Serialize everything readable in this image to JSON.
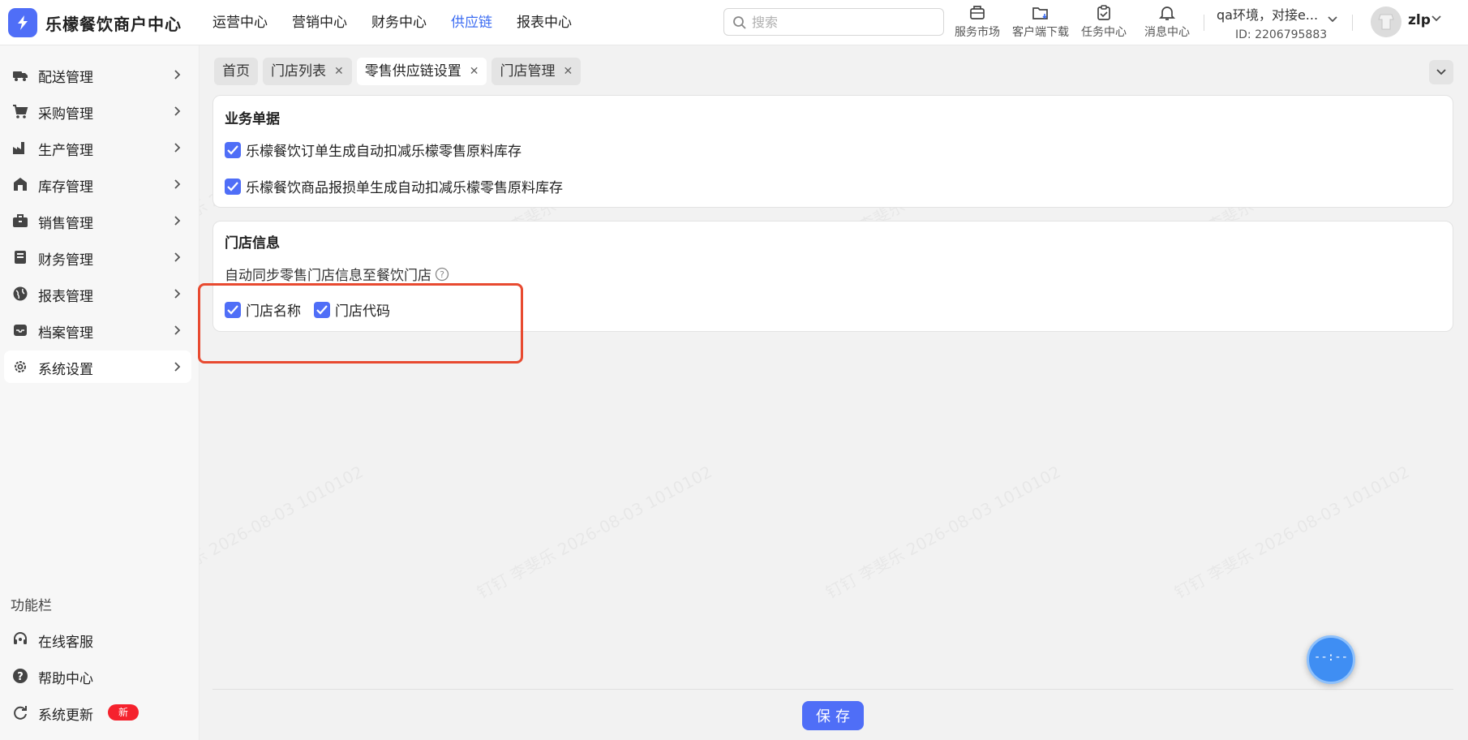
{
  "app": {
    "brand": "乐檬餐饮商户中心",
    "logo_icon": "lightning-logo-icon"
  },
  "nav": [
    {
      "label": "运营中心",
      "active": false
    },
    {
      "label": "营销中心",
      "active": false
    },
    {
      "label": "财务中心",
      "active": false
    },
    {
      "label": "供应链",
      "active": true
    },
    {
      "label": "报表中心",
      "active": false
    }
  ],
  "search": {
    "placeholder": "搜索",
    "value": ""
  },
  "tools": [
    {
      "label": "服务市场",
      "icon": "shop-icon"
    },
    {
      "label": "客户端下载",
      "icon": "download-folder-icon"
    },
    {
      "label": "任务中心",
      "icon": "clipboard-icon"
    },
    {
      "label": "消息中心",
      "icon": "bell-icon"
    }
  ],
  "account": {
    "name": "qa环境，对接e...",
    "id": "ID: 2206795883"
  },
  "user": {
    "name": "zlp"
  },
  "sidebar": {
    "items": [
      {
        "label": "配送管理",
        "icon": "truck-icon"
      },
      {
        "label": "采购管理",
        "icon": "cart-icon"
      },
      {
        "label": "生产管理",
        "icon": "factory-icon"
      },
      {
        "label": "库存管理",
        "icon": "warehouse-icon"
      },
      {
        "label": "销售管理",
        "icon": "briefcase-icon"
      },
      {
        "label": "财务管理",
        "icon": "ledger-icon"
      },
      {
        "label": "报表管理",
        "icon": "globe-icon"
      },
      {
        "label": "档案管理",
        "icon": "inbox-icon"
      },
      {
        "label": "系统设置",
        "icon": "gear-icon",
        "active": true
      }
    ],
    "func_title": "功能栏",
    "func_items": [
      {
        "label": "在线客服",
        "icon": "headset-icon"
      },
      {
        "label": "帮助中心",
        "icon": "help-circle-icon"
      },
      {
        "label": "系统更新",
        "icon": "refresh-icon",
        "badge": "新"
      }
    ]
  },
  "tabs": [
    {
      "label": "首页",
      "closable": false,
      "active": false
    },
    {
      "label": "门店列表",
      "closable": true,
      "active": false
    },
    {
      "label": "零售供应链设置",
      "closable": true,
      "active": true
    },
    {
      "label": "门店管理",
      "closable": true,
      "active": false
    }
  ],
  "business_docs": {
    "title": "业务单据",
    "options": [
      {
        "label": "乐檬餐饮订单生成自动扣减乐檬零售原料库存",
        "checked": true
      },
      {
        "label": "乐檬餐饮商品报损单生成自动扣减乐檬零售原料库存",
        "checked": true
      }
    ]
  },
  "store_info": {
    "title": "门店信息",
    "hint": "自动同步零售门店信息至餐饮门店",
    "options": [
      {
        "label": "门店名称",
        "checked": true
      },
      {
        "label": "门店代码",
        "checked": true
      }
    ]
  },
  "save_label": "保存",
  "float_button": "--:--",
  "watermark": "钉钉 李斐乐 2026-08-03 1010102",
  "colors": {
    "accent": "#4f6ef7",
    "active_nav": "#3d6df2",
    "highlight": "#e84a30",
    "badge": "#f5222d"
  }
}
